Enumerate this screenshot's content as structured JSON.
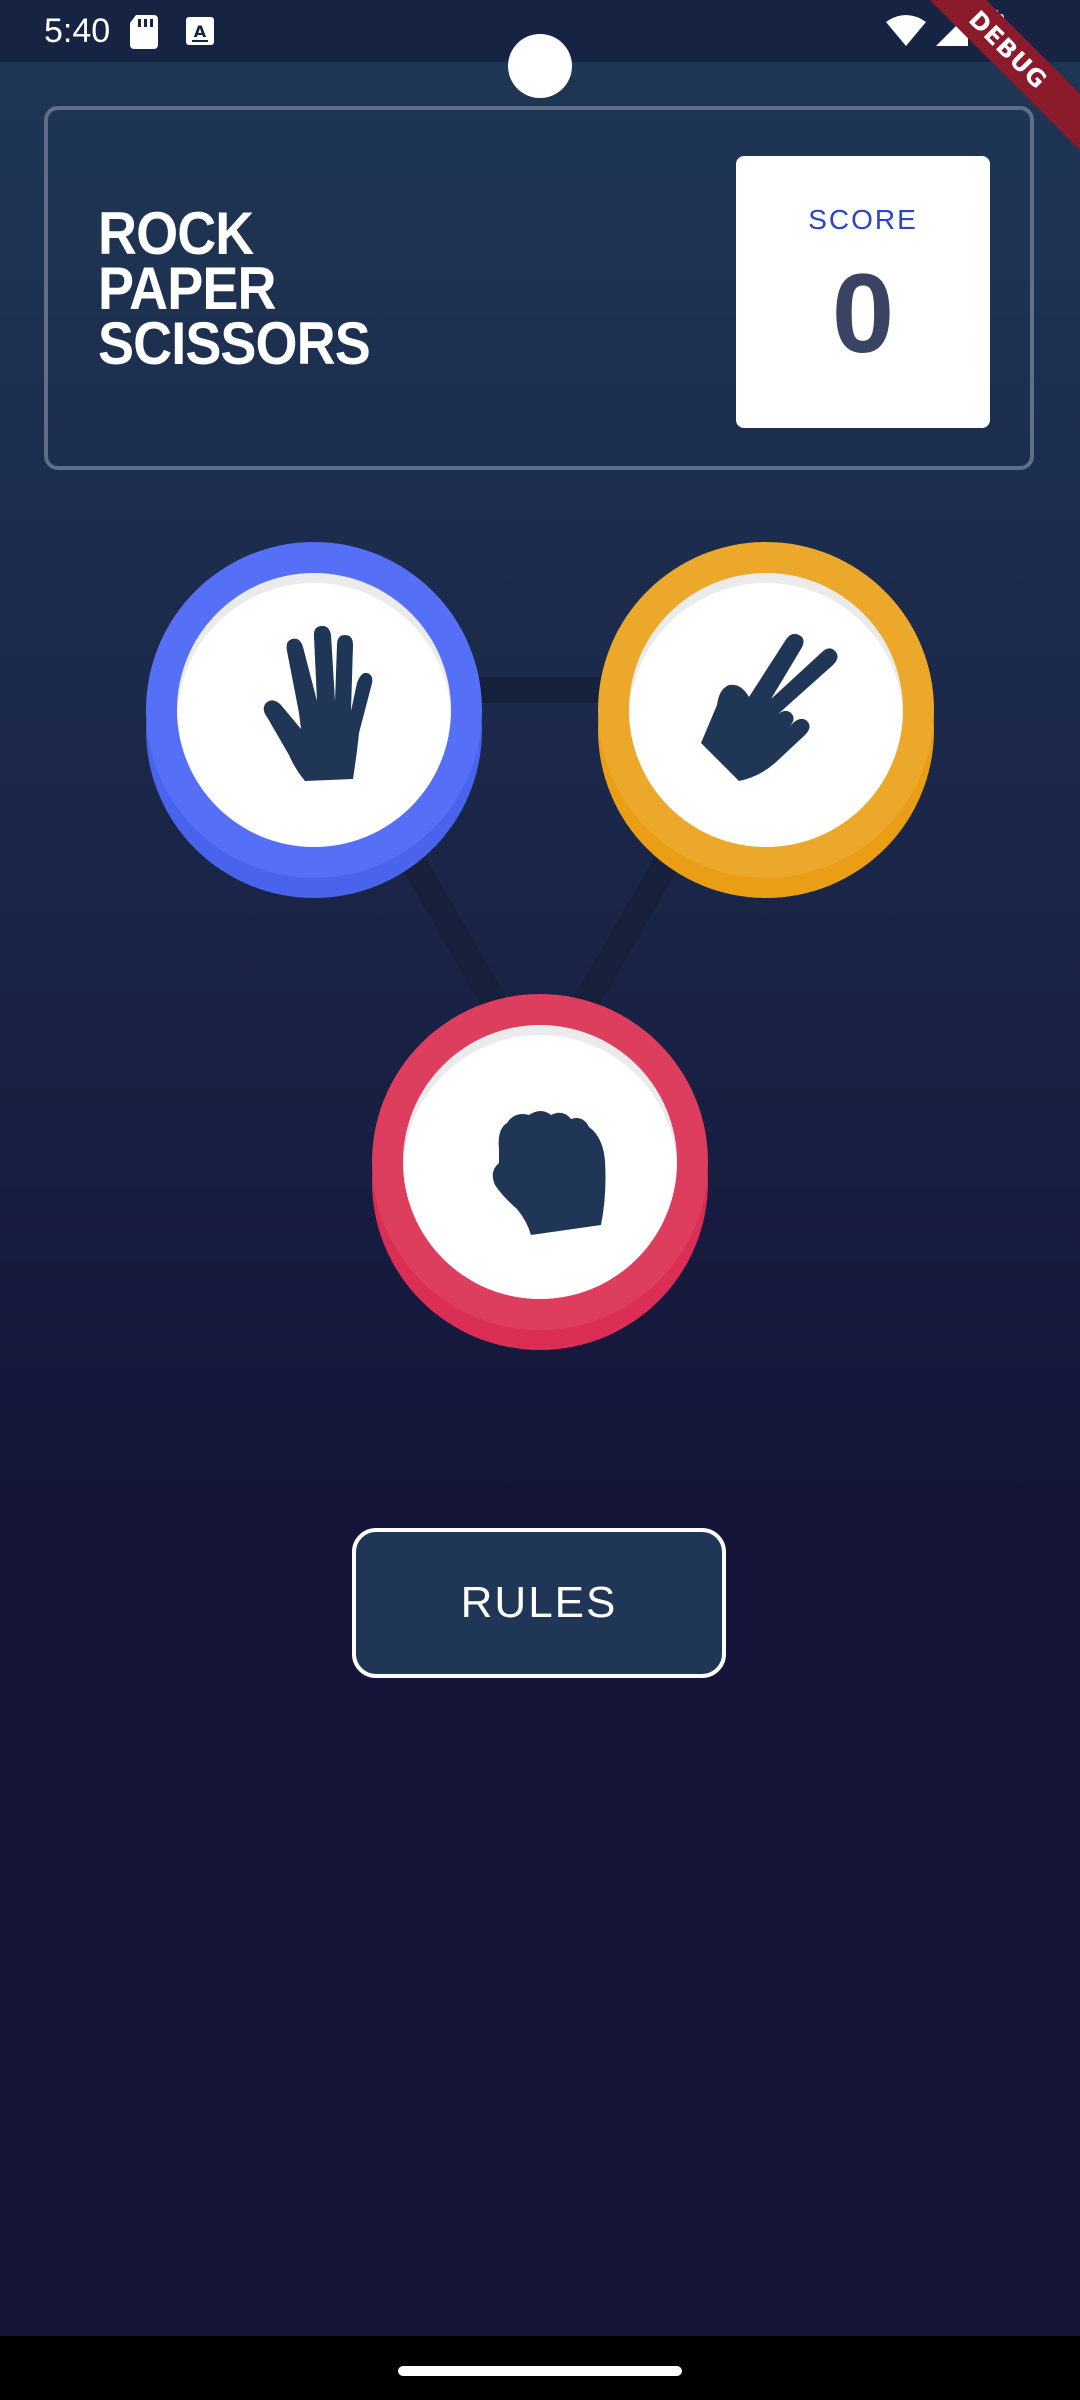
{
  "status_bar": {
    "time": "5:40",
    "icons": [
      "sd-card-icon",
      "keyboard-a-icon",
      "wifi-icon",
      "signal-icon",
      "battery-icon"
    ]
  },
  "debug_banner": "DEBUG",
  "header": {
    "title_lines": [
      "ROCK",
      "PAPER",
      "SCISSORS"
    ],
    "score_label": "SCORE",
    "score_value": "0"
  },
  "choices": [
    {
      "name": "paper",
      "icon": "paper-hand-icon",
      "color": "#5570f6"
    },
    {
      "name": "scissors",
      "icon": "scissors-hand-icon",
      "color": "#eba82a"
    },
    {
      "name": "rock",
      "icon": "rock-fist-icon",
      "color": "#de3e5d"
    }
  ],
  "rules_button": "RULES",
  "colors": {
    "background_top": "#1f3756",
    "background_bottom": "#141539",
    "header_border": "#5e6e8b",
    "score_label": "#2a46c0",
    "score_value": "#3b4363",
    "icon": "#1f3656"
  }
}
